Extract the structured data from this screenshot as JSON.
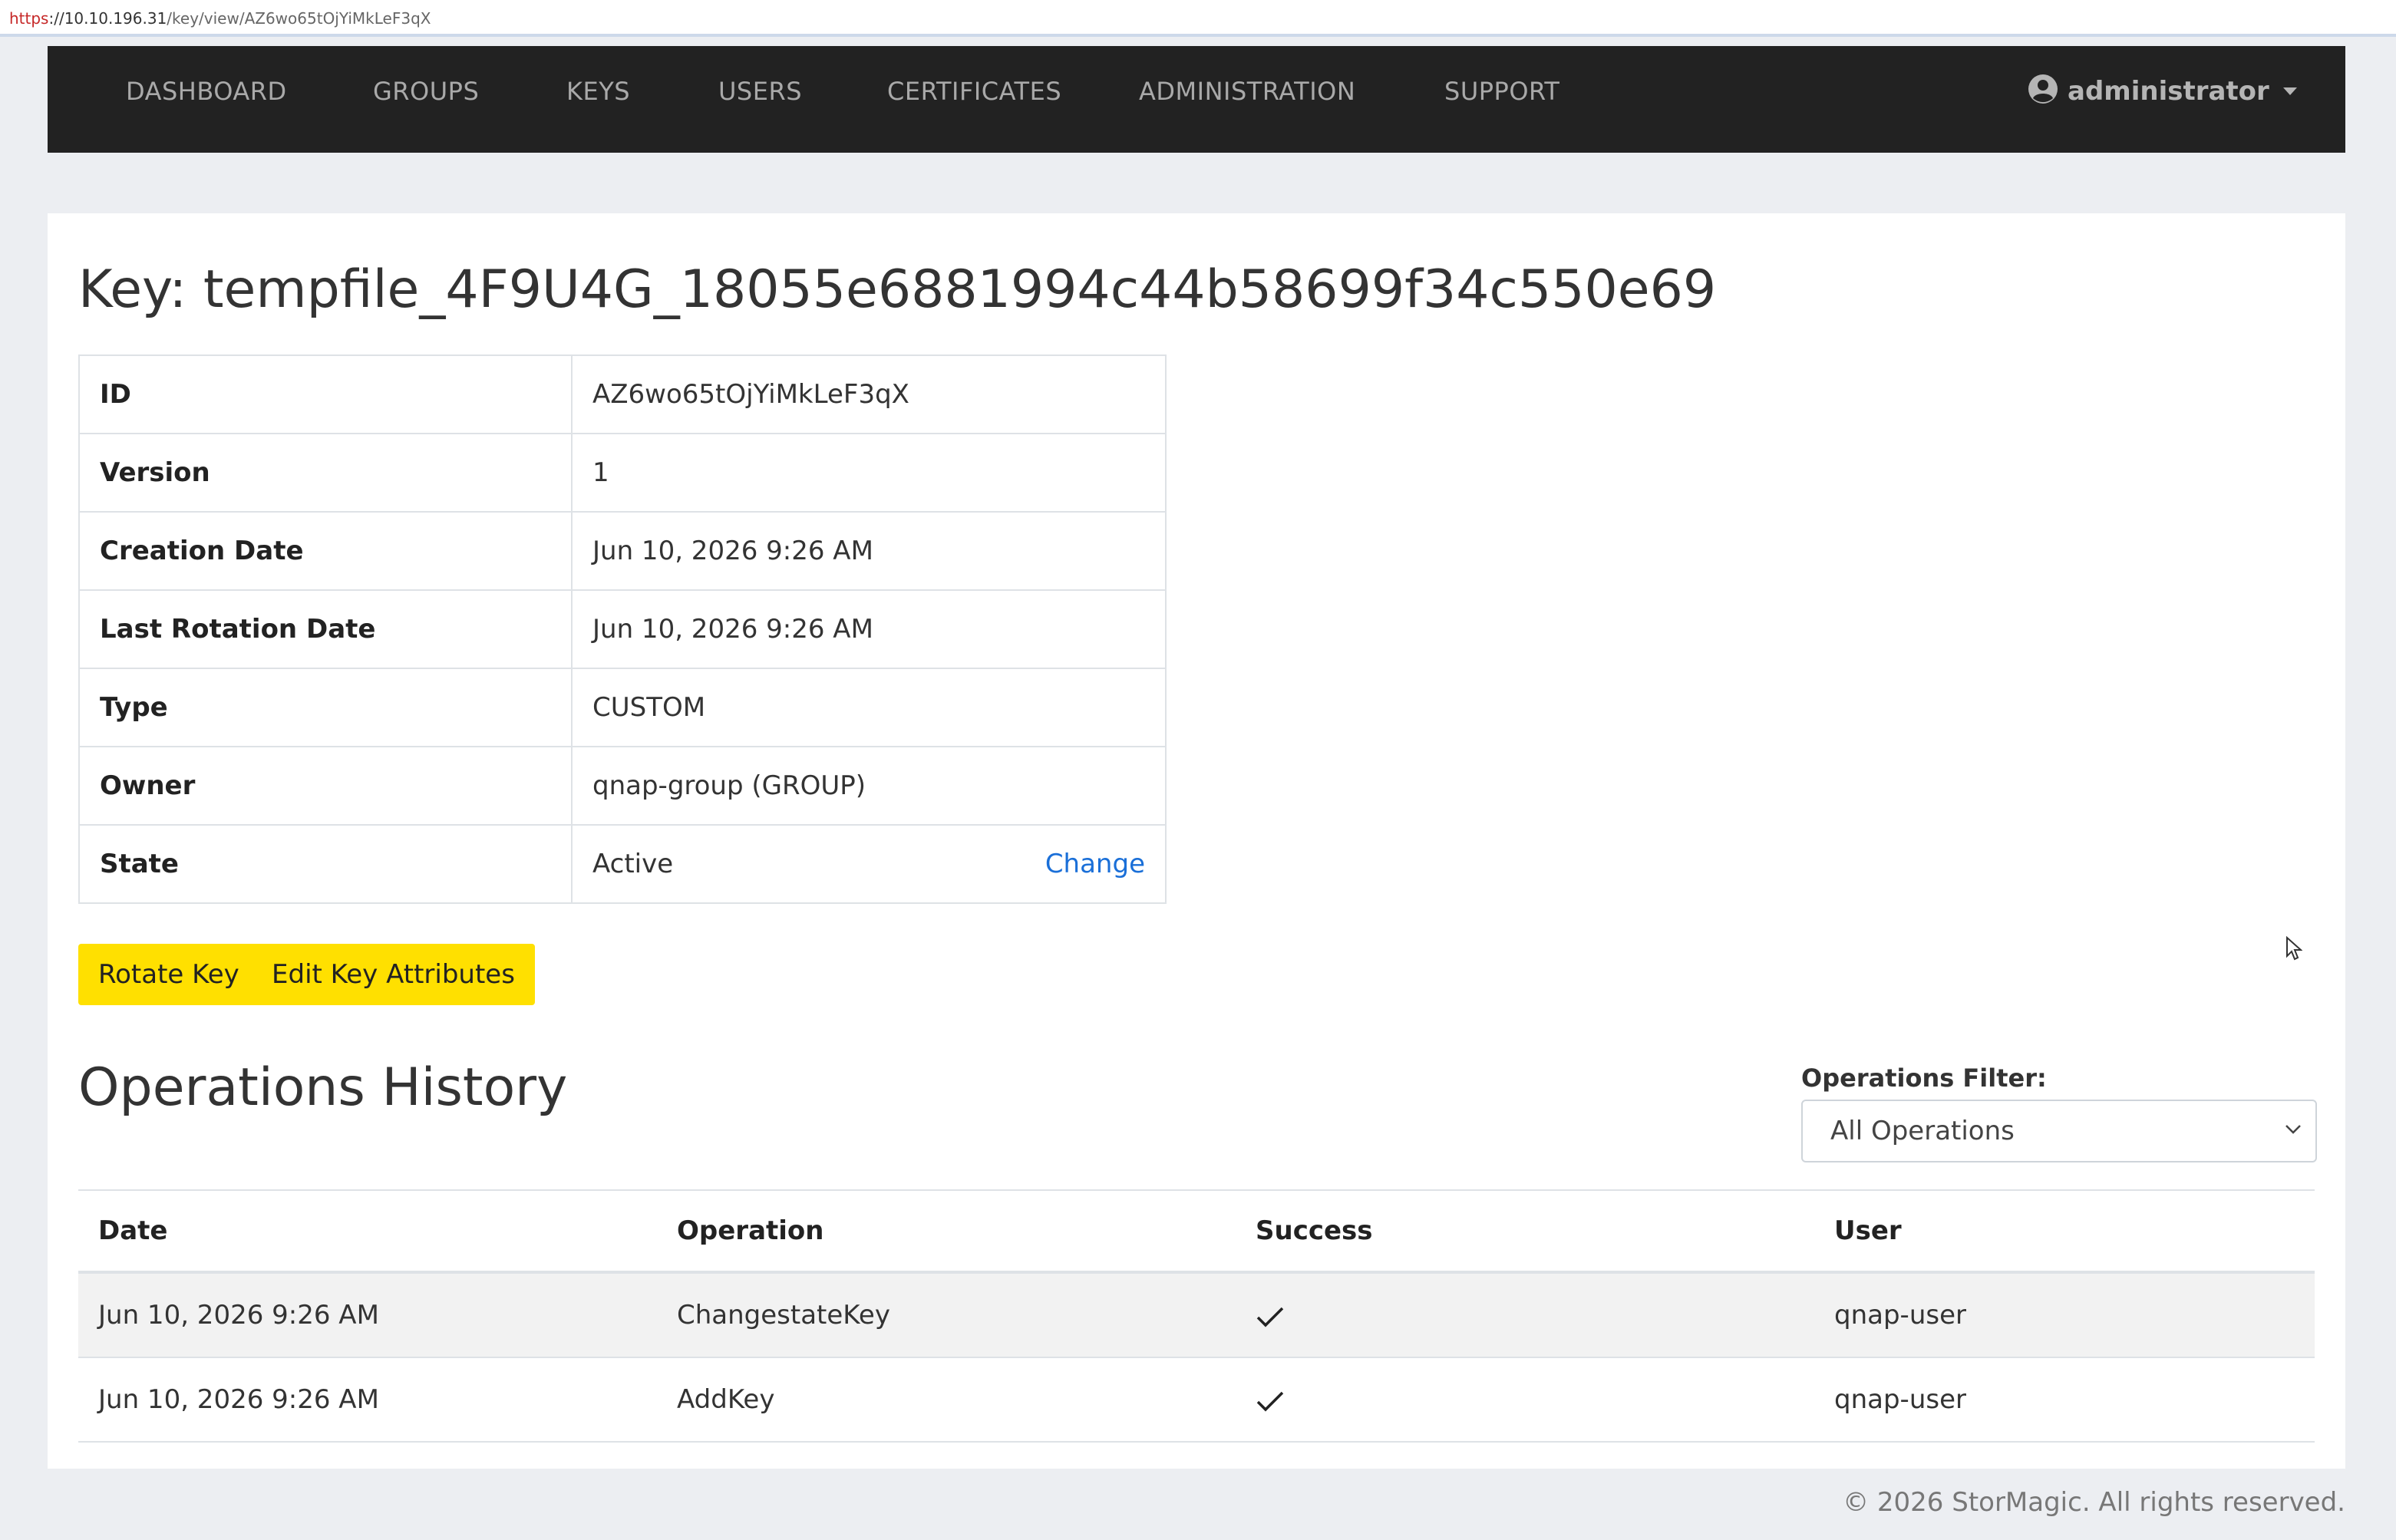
{
  "browser": {
    "url_scheme": "https",
    "url_host": "://10.10.196.31",
    "url_path": "/key/view/AZ6wo65tOjYiMkLeF3qX"
  },
  "nav": {
    "items": [
      "DASHBOARD",
      "GROUPS",
      "KEYS",
      "USERS",
      "CERTIFICATES",
      "ADMINISTRATION",
      "SUPPORT"
    ],
    "user": "administrator"
  },
  "key": {
    "title": "Key: tempfile_4F9U4G_18055e6881994c44b58699f34c550e69",
    "rows": [
      {
        "label": "ID",
        "value": "AZ6wo65tOjYiMkLeF3qX"
      },
      {
        "label": "Version",
        "value": "1"
      },
      {
        "label": "Creation Date",
        "value": "Jun 10, 2026 9:26 AM"
      },
      {
        "label": "Last Rotation Date",
        "value": "Jun 10, 2026 9:26 AM"
      },
      {
        "label": "Type",
        "value": "CUSTOM"
      },
      {
        "label": "Owner",
        "value": "qnap-group (GROUP)"
      },
      {
        "label": "State",
        "value": "Active"
      }
    ],
    "change_link": "Change"
  },
  "actions": {
    "rotate": "Rotate Key",
    "edit": "Edit Key Attributes"
  },
  "history": {
    "title": "Operations History",
    "filter_label": "Operations Filter:",
    "filter_value": "All Operations",
    "columns": [
      "Date",
      "Operation",
      "Success",
      "User"
    ],
    "rows": [
      {
        "date": "Jun 10, 2026 9:26 AM",
        "operation": "ChangestateKey",
        "success": "check-icon",
        "user": "qnap-user"
      },
      {
        "date": "Jun 10, 2026 9:26 AM",
        "operation": "AddKey",
        "success": "check-icon",
        "user": "qnap-user"
      }
    ]
  },
  "footer": "© 2026 StorMagic. All rights reserved.",
  "colors": {
    "navbar": "#222222",
    "button": "#ffe000",
    "link": "#1a6fd8",
    "background": "#eceef2"
  }
}
